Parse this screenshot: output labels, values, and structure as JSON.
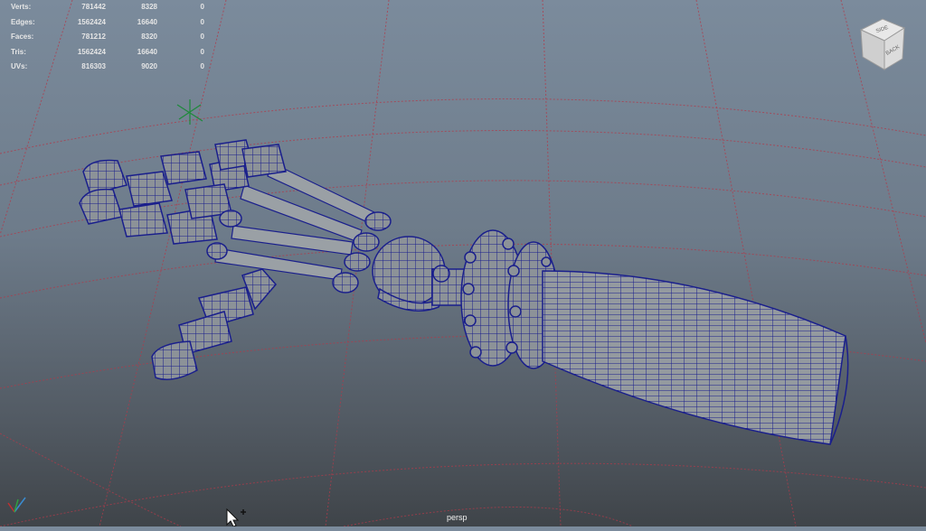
{
  "viewport": {
    "camera_name": "persp",
    "cube_faces": {
      "top": "SIDE",
      "front": "BACK"
    }
  },
  "hud_stats": [
    {
      "label": "Verts:",
      "total": "781442",
      "selection": "8328",
      "components": "0"
    },
    {
      "label": "Edges:",
      "total": "1562424",
      "selection": "16640",
      "components": "0"
    },
    {
      "label": "Faces:",
      "total": "781212",
      "selection": "8320",
      "components": "0"
    },
    {
      "label": "Tris:",
      "total": "1562424",
      "selection": "16640",
      "components": "0"
    },
    {
      "label": "UVs:",
      "total": "816303",
      "selection": "9020",
      "components": "0"
    }
  ],
  "colors": {
    "wireframe": "#1a1f8c",
    "mesh": "#8f959b",
    "grid": "#b03a4a",
    "hud_text": "#e6e6e6"
  },
  "icons": [
    "view-cube-icon",
    "axis-gizmo-icon",
    "pivot-manipulator-icon",
    "mouse-cursor-icon"
  ]
}
